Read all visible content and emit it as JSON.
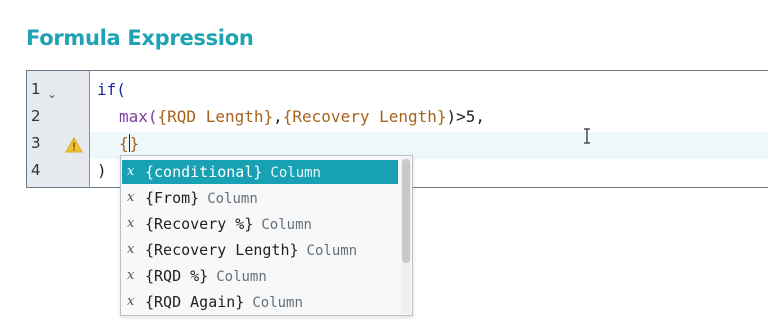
{
  "header": {
    "title": "Formula Expression"
  },
  "editor": {
    "lines": [
      {
        "number": "1"
      },
      {
        "number": "2"
      },
      {
        "number": "3"
      },
      {
        "number": "4"
      }
    ],
    "code": {
      "line1_keyword": "if(",
      "line2_fn": "max(",
      "line2_field1": "{RQD Length}",
      "line2_comma": ",",
      "line2_field2": "{Recovery Length}",
      "line2_tail": ")>5,",
      "line3_open": "{",
      "line3_close": "}",
      "line4_close": ")"
    }
  },
  "autocomplete": {
    "items": [
      {
        "type": "x",
        "label": "{conditional}",
        "kind": "Column",
        "selected": true
      },
      {
        "type": "x",
        "label": "{From}",
        "kind": "Column"
      },
      {
        "type": "x",
        "label": "{Recovery %}",
        "kind": "Column"
      },
      {
        "type": "x",
        "label": "{Recovery Length}",
        "kind": "Column"
      },
      {
        "type": "x",
        "label": "{RQD %}",
        "kind": "Column"
      },
      {
        "type": "x",
        "label": "{RQD Again}",
        "kind": "Column"
      }
    ]
  },
  "icons": {
    "fold": "chevron-down-icon",
    "warning": "warning-triangle-icon",
    "cursor": "text-cursor-icon"
  },
  "colors": {
    "accent": "#1fa2b3",
    "selection": "#17a1b3",
    "field": "#a7631c",
    "keyword": "#1a2aa0",
    "warning": "#f0c330"
  }
}
